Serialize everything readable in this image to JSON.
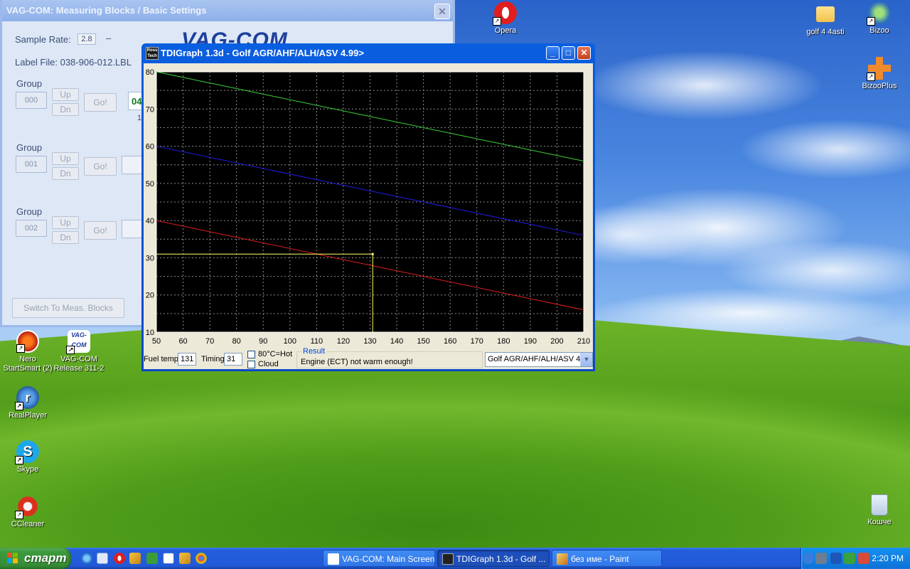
{
  "colors": {
    "graph_bg": "#000000",
    "grid": "#8c8c8c",
    "series_green": "#3cd23c",
    "series_blue": "#1e1ee6",
    "series_red": "#e11e1e",
    "marker_yellow": "#ffff66",
    "axis_text": "#ffffff"
  },
  "desktop_icons": [
    {
      "name": "nero-icon",
      "label_line1": "Nero",
      "label_line2": "StartSmart (2)"
    },
    {
      "name": "vagcom-icon",
      "label_line1": "VAG-COM",
      "label_line2": "Release 311-2"
    },
    {
      "name": "realplayer-icon",
      "label_line1": "RealPlayer",
      "label_line2": ""
    },
    {
      "name": "skype-icon",
      "label_line1": "Skype",
      "label_line2": ""
    },
    {
      "name": "ccleaner-icon",
      "label_line1": "CCleaner",
      "label_line2": ""
    },
    {
      "name": "opera-icon",
      "label_line1": "Opera",
      "label_line2": ""
    },
    {
      "name": "folder-icon",
      "label_line1": "golf 4 4asti",
      "label_line2": ""
    },
    {
      "name": "bizoo-icon",
      "label_line1": "Bizoo",
      "label_line2": ""
    },
    {
      "name": "bizooplus-icon",
      "label_line1": "BizooPlus",
      "label_line2": ""
    },
    {
      "name": "recycle-bin-icon",
      "label_line1": "Кошче",
      "label_line2": ""
    }
  ],
  "vagcom": {
    "title": "VAG-COM: Measuring Blocks / Basic Settings",
    "close_label": "✕",
    "sample_rate_label": "Sample Rate:",
    "sample_rate_value": "2.8",
    "sample_rate_dash": "–",
    "label_file": "Label File:  038-906-012.LBL",
    "brand": "VAG-COM",
    "groups": [
      {
        "label": "Group",
        "value": "000"
      },
      {
        "label": "Group",
        "value": "001"
      },
      {
        "label": "Group",
        "value": "002"
      }
    ],
    "up_label": "Up",
    "dn_label": "Dn",
    "go_label": "Go!",
    "partial_value": "04",
    "partial_sub": "1",
    "switch_label": "Switch To Meas. Blocks"
  },
  "tdigraph": {
    "title": "TDIGraph 1.3d - Golf AGR/AHF/ALH/ASV 4.99>",
    "app_icon_text": "Ross Tech",
    "min_label": "_",
    "max_label": "□",
    "close_label": "✕",
    "fuel_temp_label": "Fuel temp",
    "fuel_temp_value": "131",
    "timing_label": "Timing",
    "timing_value": "31",
    "hot_label": "80°C=Hot",
    "cloud_label": "Cloud",
    "result_legend": "Result",
    "result_text": "Engine (ECT) not warm enough!",
    "engine_select": "Golf AGR/AHF/ALH/ASV 4.99>",
    "combo_arrow": "▼"
  },
  "chart_data": {
    "type": "line",
    "title": "",
    "xlabel": "",
    "ylabel": "",
    "xlim": [
      50,
      210
    ],
    "ylim": [
      10,
      80
    ],
    "x_ticks": [
      50,
      60,
      70,
      80,
      90,
      100,
      110,
      120,
      130,
      140,
      150,
      160,
      170,
      180,
      190,
      200,
      210
    ],
    "y_ticks": [
      10,
      20,
      30,
      40,
      50,
      60,
      70,
      80
    ],
    "grid": true,
    "series": [
      {
        "color_key": "series_green",
        "x": [
          50,
          210
        ],
        "y": [
          80,
          56
        ]
      },
      {
        "color_key": "series_blue",
        "x": [
          50,
          210
        ],
        "y": [
          60,
          36
        ]
      },
      {
        "color_key": "series_red",
        "x": [
          50,
          210
        ],
        "y": [
          40,
          16
        ]
      }
    ],
    "marker": {
      "x": 131,
      "y": 31
    }
  },
  "taskbar": {
    "start_label": "старт",
    "buttons": [
      {
        "label": "VAG-COM: Main Screen",
        "active": false
      },
      {
        "label": "TDIGraph 1.3d - Golf ...",
        "active": true
      },
      {
        "label": "без име - Paint",
        "active": false
      }
    ],
    "clock": "2:20 PM"
  }
}
